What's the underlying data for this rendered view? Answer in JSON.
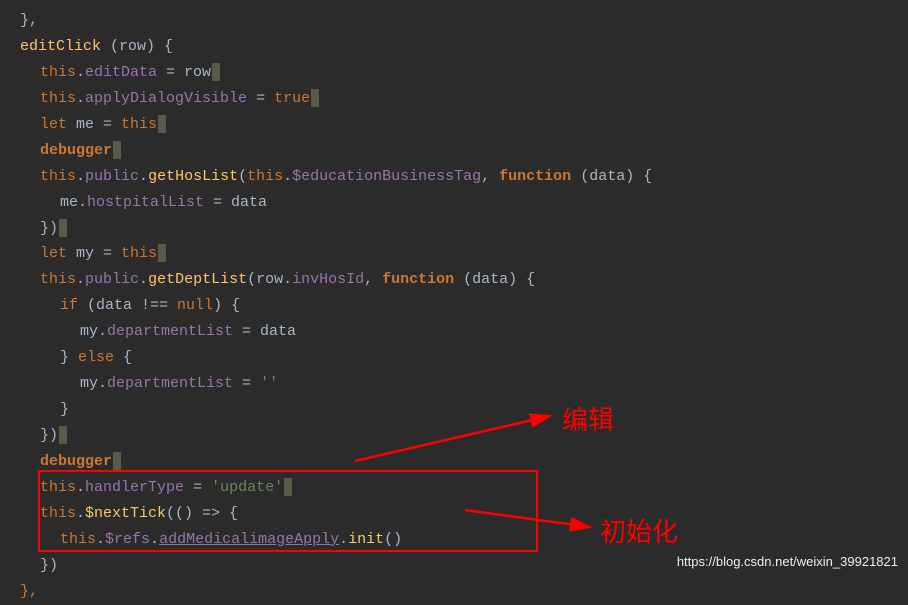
{
  "code": {
    "l0a": "},",
    "l1": {
      "fn": "editClick",
      "rest": " (row) {"
    },
    "l2": {
      "kw": "this",
      "p1": ".",
      "prop": "editData",
      "p2": " = row"
    },
    "l3": {
      "kw": "this",
      "p1": ".",
      "prop": "applyDialogVisible",
      "p2": " = ",
      "kw2": "true"
    },
    "l4": {
      "kw1": "let",
      "p1": " me = ",
      "kw2": "this"
    },
    "l5": {
      "kw": "debugger"
    },
    "l6": {
      "kw1": "this",
      "p1": ".",
      "prop1": "public",
      "p2": ".",
      "fn": "getHosList",
      "p3": "(",
      "kw2": "this",
      "p4": ".",
      "prop2": "$educationBusinessTag",
      "p5": ", ",
      "kw3": "function",
      "p6": " (data) {"
    },
    "l7": {
      "p1": "me.",
      "prop": "hostpitalList",
      "p2": " = data"
    },
    "l8": "})",
    "l9": {
      "kw1": "let",
      "p1": " my = ",
      "kw2": "this"
    },
    "l10": {
      "kw1": "this",
      "p1": ".",
      "prop1": "public",
      "p2": ".",
      "fn": "getDeptList",
      "p3": "(row.",
      "prop2": "invHosId",
      "p4": ", ",
      "kw2": "function",
      "p5": " (data) {"
    },
    "l11": {
      "kw1": "if",
      "p1": " (data !== ",
      "kw2": "null",
      "p2": ") {"
    },
    "l12": {
      "p1": "my.",
      "prop": "departmentList",
      "p2": " = data"
    },
    "l13": {
      "p1": "} ",
      "kw": "else",
      "p2": " {"
    },
    "l14": {
      "p1": "my.",
      "prop": "departmentList",
      "p2": " = ",
      "str": "''"
    },
    "l15": "}",
    "l16": "})",
    "l17": {
      "kw": "debugger"
    },
    "l18": {
      "kw": "this",
      "p1": ".",
      "prop": "handlerType",
      "p2": " = ",
      "str": "'update'"
    },
    "l19": {
      "kw": "this",
      "p1": ".",
      "fn": "$nextTick",
      "p2": "(() => {"
    },
    "l20": {
      "kw": "this",
      "p1": ".",
      "prop1": "$refs",
      "p2": ".",
      "prop2": "addMedicalimageApply",
      "p3": ".",
      "fn": "init",
      "p4": "()"
    },
    "l21": "})",
    "l22": "},"
  },
  "annotations": {
    "label1": "编辑",
    "label2": "初始化"
  },
  "watermark": "https://blog.csdn.net/weixin_39921821"
}
